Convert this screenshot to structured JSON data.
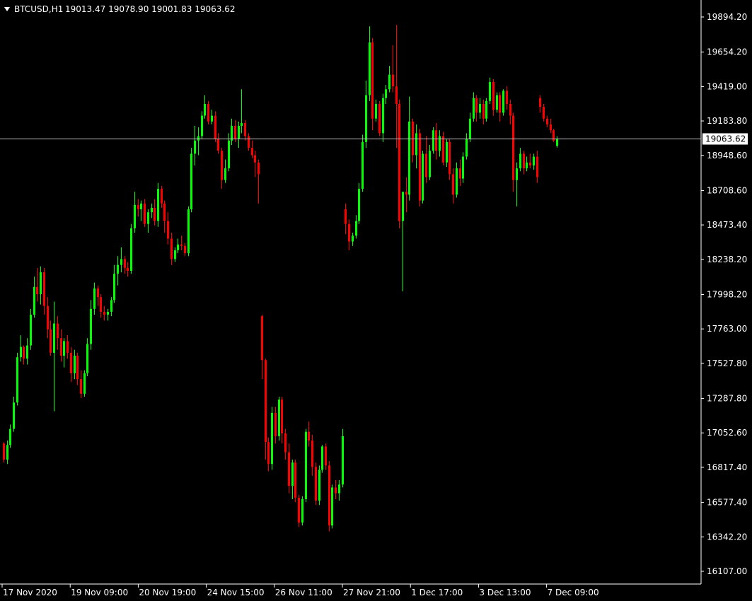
{
  "header": {
    "symbol": "BTCUSD,H1",
    "ohlc": "19013.47 19078.90 19001.83 19063.62"
  },
  "colors": {
    "background": "#000000",
    "foreground": "#ffffff",
    "bull": "#00ff00",
    "bear": "#ff0000",
    "price_line": "#c0c0c0"
  },
  "chart_data": {
    "type": "candlestick",
    "symbol": "BTCUSD",
    "timeframe": "H1",
    "ylim": [
      16000,
      20000
    ],
    "last_price": 19063.62,
    "last_price_label": "19063.62",
    "y_tick_labels": [
      "19894.20",
      "19654.20",
      "19419.00",
      "19183.80",
      "18948.60",
      "18708.60",
      "18473.40",
      "18238.20",
      "17998.20",
      "17763.00",
      "17527.80",
      "17287.80",
      "17052.60",
      "16817.40",
      "16577.40",
      "16342.20",
      "16107.00"
    ],
    "x_tick_labels": [
      "17 Nov 2020",
      "19 Nov 09:00",
      "20 Nov 19:00",
      "24 Nov 15:00",
      "26 Nov 11:00",
      "27 Nov 21:00",
      "1 Dec 17:00",
      "3 Dec 13:00",
      "7 Dec 09:00"
    ],
    "grid": false,
    "candles": [
      [
        16980,
        16990,
        16850,
        16870
      ],
      [
        16870,
        17000,
        16840,
        16970
      ],
      [
        16970,
        17110,
        16950,
        17080
      ],
      [
        17080,
        17300,
        17060,
        17260
      ],
      [
        17260,
        17600,
        17240,
        17570
      ],
      [
        17570,
        17720,
        17540,
        17640
      ],
      [
        17640,
        17650,
        17520,
        17560
      ],
      [
        17560,
        17700,
        17520,
        17650
      ],
      [
        17650,
        17900,
        17620,
        17860
      ],
      [
        17860,
        18120,
        17840,
        18050
      ],
      [
        18050,
        18180,
        17950,
        18000
      ],
      [
        18000,
        18190,
        17930,
        18150
      ],
      [
        18150,
        18180,
        17860,
        17920
      ],
      [
        17920,
        17980,
        17700,
        17760
      ],
      [
        17760,
        17820,
        17580,
        17600
      ],
      [
        17600,
        17950,
        17200,
        17800
      ],
      [
        17800,
        17850,
        17620,
        17700
      ],
      [
        17700,
        17760,
        17540,
        17580
      ],
      [
        17580,
        17700,
        17500,
        17680
      ],
      [
        17680,
        17720,
        17560,
        17600
      ],
      [
        17600,
        17640,
        17400,
        17460
      ],
      [
        17460,
        17620,
        17420,
        17580
      ],
      [
        17580,
        17600,
        17380,
        17420
      ],
      [
        17420,
        17480,
        17290,
        17320
      ],
      [
        17320,
        17480,
        17300,
        17460
      ],
      [
        17460,
        17700,
        17440,
        17660
      ],
      [
        17660,
        17960,
        17620,
        17900
      ],
      [
        17900,
        18080,
        17860,
        18040
      ],
      [
        18040,
        18060,
        17920,
        17980
      ],
      [
        17980,
        18000,
        17840,
        17880
      ],
      [
        17880,
        17920,
        17820,
        17860
      ],
      [
        17860,
        17900,
        17820,
        17880
      ],
      [
        17880,
        17980,
        17850,
        17960
      ],
      [
        17960,
        18200,
        17940,
        18140
      ],
      [
        18140,
        18260,
        18060,
        18200
      ],
      [
        18200,
        18320,
        18150,
        18240
      ],
      [
        18240,
        18260,
        18140,
        18180
      ],
      [
        18180,
        18220,
        18120,
        18160
      ],
      [
        18160,
        18480,
        18140,
        18450
      ],
      [
        18450,
        18700,
        18420,
        18610
      ],
      [
        18610,
        18650,
        18530,
        18580
      ],
      [
        18580,
        18640,
        18500,
        18620
      ],
      [
        18620,
        18650,
        18460,
        18480
      ],
      [
        18480,
        18580,
        18420,
        18560
      ],
      [
        18560,
        18620,
        18520,
        18590
      ],
      [
        18590,
        18650,
        18470,
        18500
      ],
      [
        18500,
        18760,
        18460,
        18720
      ],
      [
        18720,
        18740,
        18590,
        18620
      ],
      [
        18620,
        18640,
        18420,
        18500
      ],
      [
        18500,
        18560,
        18340,
        18380
      ],
      [
        18380,
        18420,
        18200,
        18240
      ],
      [
        18240,
        18320,
        18220,
        18300
      ],
      [
        18300,
        18380,
        18280,
        18340
      ],
      [
        18340,
        18400,
        18300,
        18330
      ],
      [
        18330,
        18350,
        18260,
        18280
      ],
      [
        18280,
        18600,
        18260,
        18580
      ],
      [
        18580,
        19000,
        18560,
        18960
      ],
      [
        18960,
        19150,
        18880,
        19050
      ],
      [
        19050,
        19140,
        18950,
        19080
      ],
      [
        19080,
        19250,
        19060,
        19220
      ],
      [
        19220,
        19360,
        19200,
        19300
      ],
      [
        19300,
        19320,
        19160,
        19180
      ],
      [
        19180,
        19260,
        19160,
        19220
      ],
      [
        19220,
        19250,
        19040,
        19060
      ],
      [
        19060,
        19100,
        18960,
        18980
      ],
      [
        18980,
        19000,
        18720,
        18780
      ],
      [
        18780,
        18920,
        18760,
        18860
      ],
      [
        18860,
        19100,
        18840,
        19050
      ],
      [
        19050,
        19200,
        19020,
        19150
      ],
      [
        19150,
        19190,
        19040,
        19060
      ],
      [
        19060,
        19180,
        19000,
        19150
      ],
      [
        19150,
        19400,
        19100,
        19170
      ],
      [
        19170,
        19190,
        19050,
        19080
      ],
      [
        19080,
        19100,
        18980,
        19000
      ],
      [
        19000,
        19050,
        18930,
        18950
      ],
      [
        18950,
        18980,
        18800,
        18900
      ],
      [
        18900,
        18920,
        18620,
        18820
      ],
      [
        17850,
        17860,
        17420,
        17550
      ],
      [
        17550,
        17560,
        16870,
        16990
      ],
      [
        16990,
        17020,
        16790,
        16840
      ],
      [
        16840,
        17230,
        16800,
        17190
      ],
      [
        17190,
        17230,
        16980,
        17030
      ],
      [
        17030,
        17300,
        17000,
        17280
      ],
      [
        17280,
        17300,
        16980,
        17050
      ],
      [
        17050,
        17080,
        16870,
        16920
      ],
      [
        16920,
        16980,
        16640,
        16690
      ],
      [
        16690,
        16870,
        16600,
        16850
      ],
      [
        16850,
        16870,
        16580,
        16610
      ],
      [
        16610,
        16630,
        16410,
        16440
      ],
      [
        16440,
        16620,
        16420,
        16600
      ],
      [
        16600,
        17080,
        16580,
        17060
      ],
      [
        17060,
        17130,
        16960,
        17000
      ],
      [
        17000,
        17040,
        16760,
        16820
      ],
      [
        16820,
        16850,
        16560,
        16590
      ],
      [
        16590,
        16830,
        16560,
        16800
      ],
      [
        16800,
        16970,
        16780,
        16960
      ],
      [
        16960,
        16980,
        16800,
        16830
      ],
      [
        16830,
        16860,
        16380,
        16420
      ],
      [
        16420,
        16700,
        16400,
        16680
      ],
      [
        16680,
        16730,
        16600,
        16640
      ],
      [
        16640,
        16730,
        16590,
        16700
      ],
      [
        16700,
        17080,
        16680,
        17030
      ],
      [
        18580,
        18620,
        18410,
        18480
      ],
      [
        18480,
        18510,
        18300,
        18360
      ],
      [
        18360,
        18420,
        18330,
        18400
      ],
      [
        18400,
        18540,
        18380,
        18500
      ],
      [
        18500,
        18760,
        18480,
        18720
      ],
      [
        18720,
        19090,
        18700,
        19040
      ],
      [
        19040,
        19460,
        19000,
        19360
      ],
      [
        19360,
        19830,
        19320,
        19720
      ],
      [
        19720,
        19750,
        19120,
        19200
      ],
      [
        19200,
        19330,
        19180,
        19300
      ],
      [
        19300,
        19320,
        19080,
        19100
      ],
      [
        19100,
        19370,
        19040,
        19340
      ],
      [
        19340,
        19430,
        19300,
        19400
      ],
      [
        19400,
        19560,
        19380,
        19500
      ],
      [
        19500,
        19700,
        19380,
        19420
      ],
      [
        19420,
        19840,
        19000,
        19300
      ],
      [
        19300,
        19330,
        18450,
        18500
      ],
      [
        18500,
        18600,
        18020,
        18700
      ],
      [
        18700,
        18800,
        18560,
        18680
      ],
      [
        18680,
        19350,
        18640,
        19180
      ],
      [
        19180,
        19200,
        18900,
        18950
      ],
      [
        18950,
        19160,
        18860,
        19100
      ],
      [
        19100,
        19130,
        18600,
        18640
      ],
      [
        18640,
        18980,
        18620,
        18960
      ],
      [
        18960,
        19080,
        18760,
        18800
      ],
      [
        18800,
        19020,
        18780,
        18980
      ],
      [
        18980,
        19140,
        18960,
        19120
      ],
      [
        19120,
        19170,
        18920,
        18980
      ],
      [
        18980,
        19120,
        18940,
        19080
      ],
      [
        19080,
        19110,
        18880,
        18900
      ],
      [
        18900,
        19060,
        18870,
        19040
      ],
      [
        19040,
        19060,
        18780,
        18820
      ],
      [
        18820,
        18860,
        18620,
        18680
      ],
      [
        18680,
        18900,
        18660,
        18860
      ],
      [
        18860,
        18920,
        18740,
        18790
      ],
      [
        18790,
        18970,
        18760,
        18940
      ],
      [
        18940,
        19100,
        18920,
        19060
      ],
      [
        19060,
        19240,
        19040,
        19200
      ],
      [
        19200,
        19380,
        19180,
        19340
      ],
      [
        19340,
        19360,
        19180,
        19240
      ],
      [
        19240,
        19340,
        19200,
        19300
      ],
      [
        19300,
        19330,
        19160,
        19200
      ],
      [
        19200,
        19340,
        19180,
        19320
      ],
      [
        19320,
        19480,
        19300,
        19450
      ],
      [
        19450,
        19470,
        19220,
        19260
      ],
      [
        19260,
        19380,
        19240,
        19360
      ],
      [
        19360,
        19380,
        19180,
        19240
      ],
      [
        19240,
        19400,
        19220,
        19390
      ],
      [
        19390,
        19420,
        19260,
        19300
      ],
      [
        19300,
        19330,
        19160,
        19220
      ],
      [
        19220,
        19240,
        18700,
        18780
      ],
      [
        18780,
        18900,
        18600,
        18860
      ],
      [
        18860,
        19000,
        18840,
        18960
      ],
      [
        18960,
        18980,
        18820,
        18860
      ],
      [
        18860,
        18940,
        18840,
        18900
      ],
      [
        18900,
        18960,
        18860,
        18880
      ],
      [
        18880,
        18960,
        18850,
        18940
      ],
      [
        18940,
        18980,
        18760,
        18800
      ],
      [
        19340,
        19360,
        19240,
        19280
      ],
      [
        19280,
        19300,
        19180,
        19200
      ],
      [
        19200,
        19220,
        19140,
        19160
      ],
      [
        19160,
        19200,
        19100,
        19120
      ],
      [
        19120,
        19130,
        19040,
        19050
      ],
      [
        19013.47,
        19078.9,
        19001.83,
        19063.62
      ]
    ]
  }
}
